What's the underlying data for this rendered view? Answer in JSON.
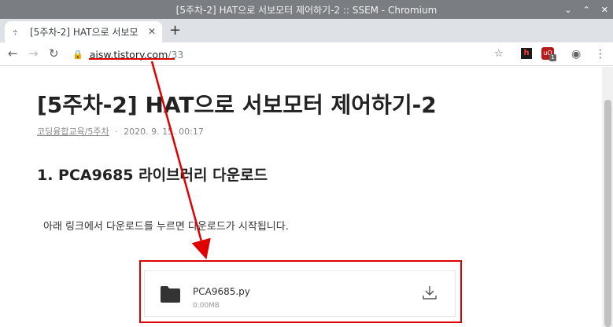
{
  "window": {
    "title": "[5주차-2] HAT으로 서보모터 제어하기-2 :: SSEM - Chromium"
  },
  "tab": {
    "title": "[5주차-2] HAT으로 서보모",
    "close_icon": "close-icon",
    "new_tab_icon": "plus-icon"
  },
  "toolbar": {
    "url_host": "aisw.tistory.com",
    "url_path": "/33"
  },
  "post": {
    "title": "[5주차-2] HAT으로 서보모터 제어하기-2",
    "category": "코딩융합교육/5주차",
    "separator": "·",
    "date": "2020. 9. 15. 00:17",
    "section_heading": "1. PCA9685 라이브러리 다운로드",
    "paragraph": "아래 링크에서 다운로드를 누르면 다운로드가 시작됩니다."
  },
  "attachment": {
    "file_name": "PCA9685.py",
    "file_size": "0.00MB"
  },
  "annotation_color": "#e00000"
}
